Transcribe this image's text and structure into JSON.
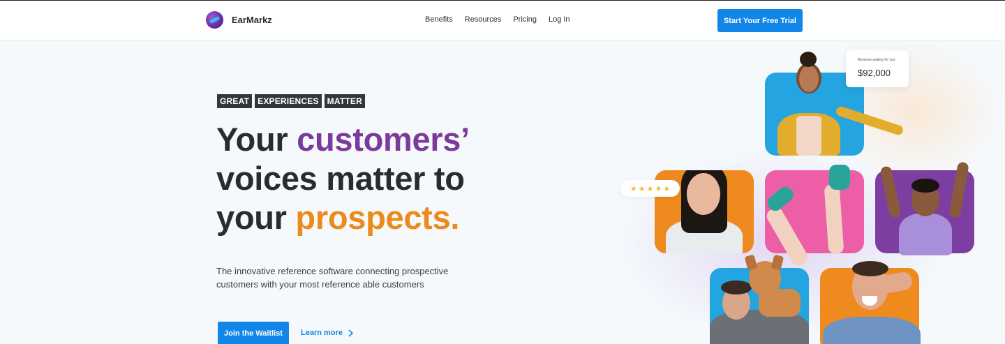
{
  "brand": {
    "name": "EarMarkz"
  },
  "nav": {
    "items": [
      "Benefits",
      "Resources",
      "Pricing",
      "Log In"
    ]
  },
  "header": {
    "cta_label": "Start Your Free Trial"
  },
  "hero": {
    "tags": [
      "GREAT",
      "EXPERIENCES",
      "MATTER"
    ],
    "headline": {
      "part1": "Your ",
      "accent1": "customers’",
      "part2": " voices matter to your ",
      "accent2": "prospects."
    },
    "subtext": "The innovative reference software connecting prospective customers with your most reference able customers",
    "primary_cta": "Join the Waitlist",
    "secondary_cta": "Learn more"
  },
  "collage": {
    "revenue_card": {
      "label": "Revenue waiting for you",
      "value": "$92,000"
    },
    "rating": {
      "stars": 5
    },
    "tiles": [
      {
        "name": "woman-yellow-jacket",
        "bg": "#24a4e0"
      },
      {
        "name": "woman-smiling",
        "bg": "#ee8a1e"
      },
      {
        "name": "legs-sneakers",
        "bg": "#ec5ea6"
      },
      {
        "name": "man-celebrating",
        "bg": "#7d3ea1"
      },
      {
        "name": "man-with-dog",
        "bg": "#24a4e0"
      },
      {
        "name": "man-covering-eyes",
        "bg": "#ee8a1e"
      }
    ]
  },
  "colors": {
    "accent": "#1186e8",
    "purple": "#7b3a9c",
    "orange": "#ec8a1c",
    "dark_tag": "#33373d"
  }
}
